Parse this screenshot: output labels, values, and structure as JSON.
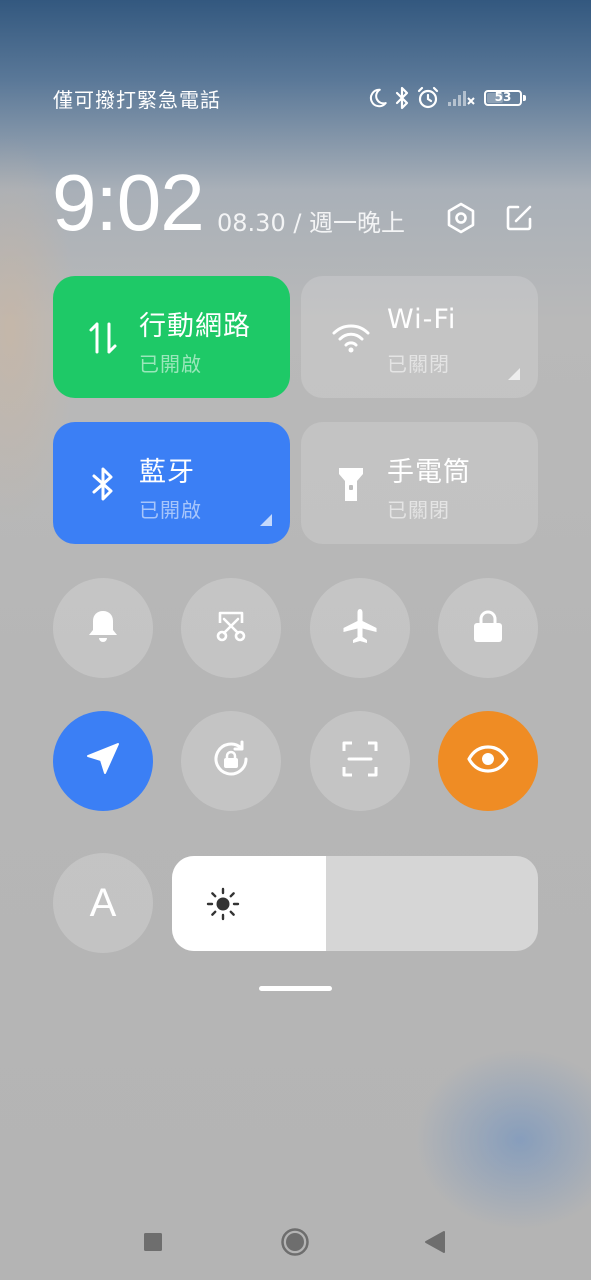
{
  "status_bar": {
    "carrier_text": "僅可撥打緊急電話",
    "battery_level": "53",
    "battery_fraction": 0.53,
    "icons": [
      "moon-icon",
      "bluetooth-icon",
      "alarm-icon",
      "signal-icon",
      "battery-icon"
    ]
  },
  "header": {
    "time": "9:02",
    "date": "08.30 / 週一晚上",
    "settings_icon": "hexagon-settings-icon",
    "edit_icon": "edit-icon"
  },
  "tiles": {
    "mobile_data": {
      "title": "行動網路",
      "status": "已開啟",
      "color": "#1ec967",
      "icon": "data-arrows-icon"
    },
    "wifi": {
      "title": "Wi-Fi",
      "status": "已關閉",
      "icon": "wifi-icon"
    },
    "bluetooth": {
      "title": "藍牙",
      "status": "已開啟",
      "color": "#3b7ff5",
      "icon": "bluetooth-icon"
    },
    "flashlight": {
      "title": "手電筒",
      "status": "已關閉",
      "icon": "flashlight-icon"
    }
  },
  "toggles": [
    {
      "name": "bell",
      "icon": "bell-icon",
      "active": false
    },
    {
      "name": "screenshot",
      "icon": "scissors-icon",
      "active": false
    },
    {
      "name": "airplane",
      "icon": "airplane-icon",
      "active": false
    },
    {
      "name": "lock",
      "icon": "lock-icon",
      "active": false
    },
    {
      "name": "location",
      "icon": "location-arrow-icon",
      "active": true,
      "color": "#3b7ff5"
    },
    {
      "name": "rotation-lock",
      "icon": "rotate-lock-icon",
      "active": false
    },
    {
      "name": "scanner",
      "icon": "scan-icon",
      "active": false
    },
    {
      "name": "reading-mode",
      "icon": "eye-icon",
      "active": true,
      "color": "#ef8c24"
    }
  ],
  "auto_brightness": {
    "label": "A"
  },
  "brightness": {
    "level": 0.42,
    "icon": "sun-icon"
  },
  "nav": {
    "icons": [
      "square-icon",
      "circle-icon",
      "back-triangle-icon"
    ]
  }
}
